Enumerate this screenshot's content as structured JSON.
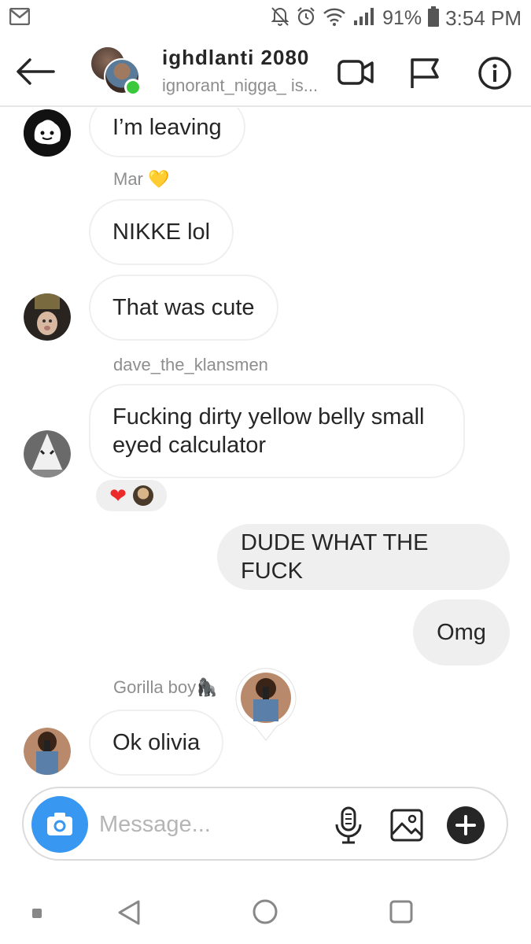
{
  "status_bar": {
    "battery": "91%",
    "time": "3:54 PM",
    "icons": [
      "gmail-icon",
      "mute-icon",
      "alarm-icon",
      "wifi-icon",
      "signal-icon",
      "battery-icon"
    ]
  },
  "header": {
    "title": "ighdlanti 2080",
    "subtitle": "ignorant_nigga_ is...",
    "icons": [
      "back-arrow-icon",
      "video-call-icon",
      "flag-icon",
      "info-icon"
    ]
  },
  "messages": [
    {
      "text": "I’m leaving",
      "mine": false
    },
    {
      "sender": "Mar",
      "sender_emoji": "💛",
      "text": "NIKKE lol",
      "mine": false
    },
    {
      "text": "That was cute",
      "mine": false
    },
    {
      "sender": "dave_the_klansmen",
      "text": "Fucking dirty yellow belly small eyed calculator",
      "mine": false,
      "reactions": [
        "❤️",
        "avatar"
      ]
    },
    {
      "text": "DUDE WHAT THE FUCK",
      "mine": true
    },
    {
      "text": "Omg",
      "mine": true
    },
    {
      "sender": "Gorilla boy",
      "sender_emoji": "🦍",
      "text": "Ok olivia",
      "mine": false
    }
  ],
  "composer": {
    "placeholder": "Message...",
    "icons": [
      "camera-icon",
      "microphone-icon",
      "gallery-icon",
      "plus-icon"
    ]
  },
  "nav": {
    "icons": [
      "recent-dot-icon",
      "back-triangle-icon",
      "home-circle-icon",
      "overview-square-icon"
    ]
  }
}
